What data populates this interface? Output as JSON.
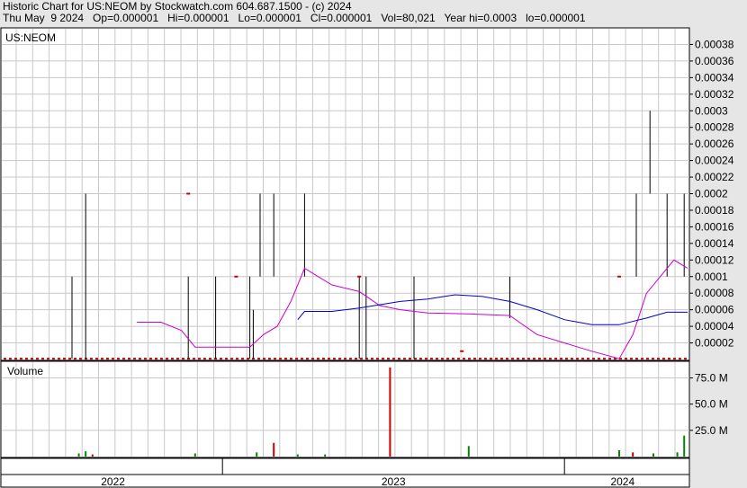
{
  "header": {
    "title": "Historic Chart for US:NEOM by Stockwatch.com 604.687.1500 - (c) 2024",
    "summary": "Thu May  9 2024   Op=0.000001   Hi=0.000001   Lo=0.000001   Cl=0.000001   Vol=80,021   Year hi=0.0003   lo=0.000001"
  },
  "colors": {
    "price": "#cc0000",
    "ma_short": "#cc00cc",
    "ma_long": "#0000cc",
    "volume_up": "#008800",
    "volume_down": "#cc0000",
    "grid": "#c8c8c8"
  },
  "chart_data": [
    {
      "type": "line",
      "title": "US:NEOM",
      "ylim": [
        0,
        0.0004
      ],
      "y_ticks": [
        "0.00002",
        "0.00004",
        "0.00006",
        "0.00008",
        "0.0001",
        "0.00012",
        "0.00014",
        "0.00016",
        "0.00018",
        "0.0002",
        "0.00022",
        "0.00024",
        "0.00026",
        "0.00028",
        "0.0003",
        "0.00032",
        "0.00034",
        "0.00036",
        "0.00038"
      ],
      "x_axis_labels": [
        "2022",
        "2023",
        "2024"
      ],
      "grid": true,
      "price_bars": [
        {
          "t": 0.1,
          "hi": 0.0001,
          "lo": 1e-06
        },
        {
          "t": 0.12,
          "hi": 0.0002,
          "lo": 1e-06
        },
        {
          "t": 0.2,
          "hi": 0.0001,
          "lo": 0.0001
        },
        {
          "t": 0.27,
          "hi": 0.0001,
          "lo": 1e-06
        },
        {
          "t": 0.31,
          "hi": 0.0001,
          "lo": 1e-06
        },
        {
          "t": 0.36,
          "hi": 0.0001,
          "lo": 1e-06
        },
        {
          "t": 0.365,
          "hi": 6e-05,
          "lo": 1e-06
        },
        {
          "t": 0.375,
          "hi": 0.0002,
          "lo": 0.0001
        },
        {
          "t": 0.395,
          "hi": 0.0002,
          "lo": 0.0001
        },
        {
          "t": 0.44,
          "hi": 0.0002,
          "lo": 0.0001
        },
        {
          "t": 0.52,
          "hi": 0.0001,
          "lo": 1e-06
        },
        {
          "t": 0.53,
          "hi": 0.0001,
          "lo": 1e-06
        },
        {
          "t": 0.6,
          "hi": 0.0001,
          "lo": 1e-06
        },
        {
          "t": 0.74,
          "hi": 0.0001,
          "lo": 5e-05
        },
        {
          "t": 0.925,
          "hi": 0.0002,
          "lo": 0.0001
        },
        {
          "t": 0.945,
          "hi": 0.0003,
          "lo": 0.0002
        },
        {
          "t": 0.97,
          "hi": 0.0002,
          "lo": 0.0001
        },
        {
          "t": 0.995,
          "hi": 0.0002,
          "lo": 0.0001
        }
      ],
      "price_ticks": [
        {
          "t": 0.27,
          "v": 0.0002
        },
        {
          "t": 0.34,
          "v": 0.0001
        },
        {
          "t": 0.52,
          "v": 0.0001
        },
        {
          "t": 0.67,
          "v": 1e-05
        },
        {
          "t": 0.9,
          "v": 0.0001
        }
      ],
      "series": [
        {
          "points": [
            [
              0.195,
              4.5e-05
            ],
            [
              0.23,
              4.5e-05
            ],
            [
              0.26,
              3.5e-05
            ],
            [
              0.28,
              1.5e-05
            ],
            [
              0.36,
              1.5e-05
            ],
            [
              0.38,
              3e-05
            ],
            [
              0.4,
              4e-05
            ],
            [
              0.42,
              7e-05
            ],
            [
              0.44,
              0.00011
            ],
            [
              0.46,
              0.0001
            ],
            [
              0.48,
              9e-05
            ],
            [
              0.52,
              8.2e-05
            ],
            [
              0.55,
              6.5e-05
            ],
            [
              0.58,
              6e-05
            ],
            [
              0.62,
              5.6e-05
            ],
            [
              0.68,
              5.5e-05
            ],
            [
              0.74,
              5.3e-05
            ],
            [
              0.78,
              3e-05
            ],
            [
              0.82,
              2e-05
            ],
            [
              0.86,
              1e-05
            ],
            [
              0.9,
              1e-06
            ],
            [
              0.92,
              3e-05
            ],
            [
              0.94,
              8e-05
            ],
            [
              0.96,
              0.0001
            ],
            [
              0.98,
              0.00012
            ],
            [
              1.0,
              0.00011
            ]
          ]
        },
        {
          "points": [
            [
              0.43,
              4.8e-05
            ],
            [
              0.44,
              5.8e-05
            ],
            [
              0.48,
              5.8e-05
            ],
            [
              0.52,
              6.2e-05
            ],
            [
              0.58,
              7e-05
            ],
            [
              0.62,
              7.3e-05
            ],
            [
              0.66,
              7.8e-05
            ],
            [
              0.7,
              7.6e-05
            ],
            [
              0.74,
              7e-05
            ],
            [
              0.78,
              6e-05
            ],
            [
              0.82,
              4.8e-05
            ],
            [
              0.86,
              4.2e-05
            ],
            [
              0.9,
              4.2e-05
            ],
            [
              0.94,
              5e-05
            ],
            [
              0.97,
              5.7e-05
            ],
            [
              1.0,
              5.7e-05
            ]
          ]
        }
      ]
    },
    {
      "type": "bar",
      "title": "Volume",
      "ylim": [
        0,
        90
      ],
      "y_ticks": [
        "25.0 M",
        "50.0 M",
        "75.0 M"
      ],
      "bars": [
        {
          "t": 0.11,
          "v": 3,
          "dir": "up"
        },
        {
          "t": 0.12,
          "v": 5,
          "dir": "up"
        },
        {
          "t": 0.13,
          "v": 2,
          "dir": "down"
        },
        {
          "t": 0.28,
          "v": 3,
          "dir": "up"
        },
        {
          "t": 0.37,
          "v": 4,
          "dir": "up"
        },
        {
          "t": 0.395,
          "v": 13,
          "dir": "down"
        },
        {
          "t": 0.43,
          "v": 2,
          "dir": "up"
        },
        {
          "t": 0.47,
          "v": 2,
          "dir": "up"
        },
        {
          "t": 0.565,
          "v": 85,
          "dir": "down"
        },
        {
          "t": 0.68,
          "v": 10,
          "dir": "up"
        },
        {
          "t": 0.9,
          "v": 6,
          "dir": "up"
        },
        {
          "t": 0.92,
          "v": 4,
          "dir": "down"
        },
        {
          "t": 0.95,
          "v": 3,
          "dir": "up"
        },
        {
          "t": 0.985,
          "v": 4,
          "dir": "up"
        },
        {
          "t": 0.995,
          "v": 20,
          "dir": "up"
        }
      ]
    }
  ]
}
